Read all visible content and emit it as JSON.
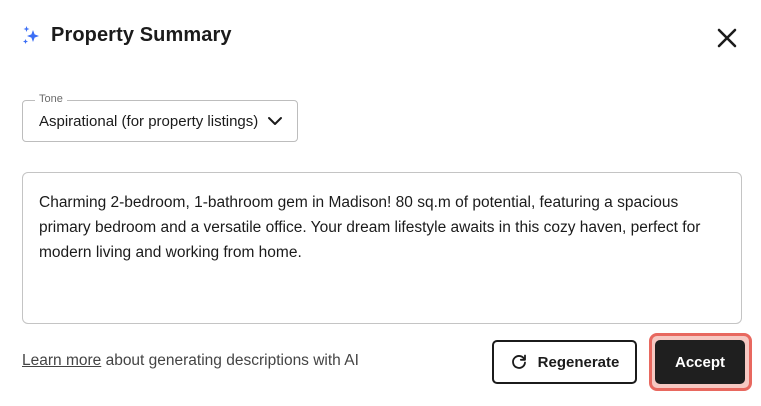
{
  "dialog": {
    "title": "Property Summary",
    "close_icon": "close-icon",
    "title_icon": "sparkle-icon"
  },
  "tone": {
    "label": "Tone",
    "value": "Aspirational (for property listings)"
  },
  "summary": {
    "text": "Charming 2-bedroom, 1-bathroom gem in Madison! 80 sq.m of potential, featuring a spacious primary bedroom and a versatile office. Your dream lifestyle awaits in this cozy haven, perfect for modern living and working from home."
  },
  "footer": {
    "learn_more_link": "Learn more",
    "learn_more_rest": " about generating descriptions with AI",
    "regenerate_label": "Regenerate",
    "accept_label": "Accept"
  },
  "colors": {
    "accent_blue": "#3b6ef5",
    "primary_button": "#1f1f1f",
    "highlight_ring": "#e8685f"
  }
}
